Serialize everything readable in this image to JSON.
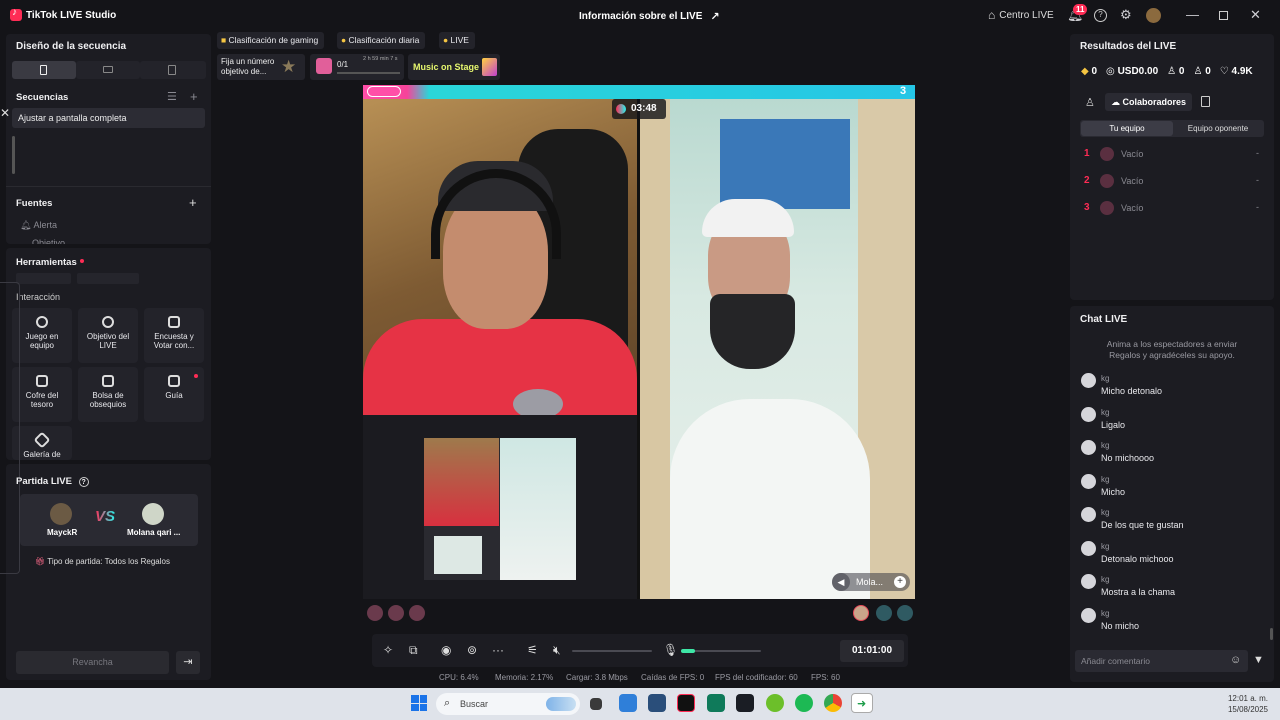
{
  "window": {
    "app_title": "TikTok LIVE Studio",
    "center_title": "Información sobre el LIVE",
    "centro_live": "Centro LIVE",
    "notification_count": "11"
  },
  "left": {
    "scene_design_title": "Diseño de la secuencia",
    "sequences_title": "Secuencias",
    "sequence_item": "Ajustar a pantalla completa",
    "sources_title": "Fuentes",
    "source_item_1": "Alerta",
    "source_item_2": "Objetivo",
    "tools_title": "Herramientas",
    "interaction_title": "Interacción",
    "tools": [
      {
        "line1": "Juego en",
        "line2": "equipo"
      },
      {
        "line1": "Objetivo del",
        "line2": "LIVE"
      },
      {
        "line1": "Encuesta y",
        "line2": "Votar con..."
      },
      {
        "line1": "Cofre del",
        "line2": "tesoro"
      },
      {
        "line1": "Bolsa de",
        "line2": "obsequios"
      },
      {
        "line1": "Guía",
        "line2": ""
      },
      {
        "line1": "Galería de",
        "line2": ""
      }
    ],
    "match_title": "Partida LIVE",
    "player1": "MayckR",
    "player2": "Molana qari ...",
    "vs": "VS",
    "match_type": "Tipo de partida: Todos los Regalos",
    "rematch_button": "Revancha"
  },
  "top_tags": {
    "gaming_rank": "Clasificación de gaming",
    "daily_rank": "Clasificación diaria",
    "live": "LIVE",
    "goal_text_1": "Fija un número",
    "goal_text_2": "objetivo de...",
    "gift_progress": "0/1",
    "gift_timer": "2 h 59 min 7 s",
    "music_on_stage": "Music on Stage"
  },
  "stage": {
    "battle_timer": "03:48",
    "right_score": "3",
    "opponent_label": "Mola...",
    "live_timer": "01:01:00"
  },
  "stats": {
    "cpu": "CPU:  6.4%",
    "memory": "Memoria:  2.17%",
    "load": "Cargar:  3.8 Mbps",
    "fps_drops": "Caídas de FPS:  0",
    "encoder_fps": "FPS del codificador:  60",
    "fps": "FPS:  60"
  },
  "right": {
    "results_title": "Resultados del LIVE",
    "diamonds": "0",
    "usd": "USD0.00",
    "viewers": "0",
    "new_followers": "0",
    "likes": "4.9K",
    "collaborators": "Colaboradores",
    "tab_my_team": "Tu equipo",
    "tab_opponent": "Equipo oponente",
    "slots": [
      {
        "rank": "1",
        "name": "Vacío",
        "value": "-"
      },
      {
        "rank": "2",
        "name": "Vacío",
        "value": "-"
      },
      {
        "rank": "3",
        "name": "Vacío",
        "value": "-"
      }
    ],
    "chat_title": "Chat LIVE",
    "chat_hint_1": "Anima a los espectadores a enviar",
    "chat_hint_2": "Regalos y agradéceles su apoyo.",
    "chat": [
      {
        "user": "kg",
        "text": "Micho detonalo"
      },
      {
        "user": "kg",
        "text": "Ligalo"
      },
      {
        "user": "kg",
        "text": "No michoooo"
      },
      {
        "user": "kg",
        "text": "Micho"
      },
      {
        "user": "kg",
        "text": "De los que te gustan"
      },
      {
        "user": "kg",
        "text": "Detonalo michooo"
      },
      {
        "user": "kg",
        "text": "Mostra a la chama"
      },
      {
        "user": "kg",
        "text": "No micho"
      }
    ],
    "comment_placeholder": "Añadir comentario"
  },
  "taskbar": {
    "search": "Buscar",
    "time": "12:01 a. m.",
    "date": "15/08/2025"
  },
  "colors": {
    "accent_pink": "#fe2c55",
    "accent_teal": "#25f4ee",
    "panel": "#1c1c22"
  }
}
